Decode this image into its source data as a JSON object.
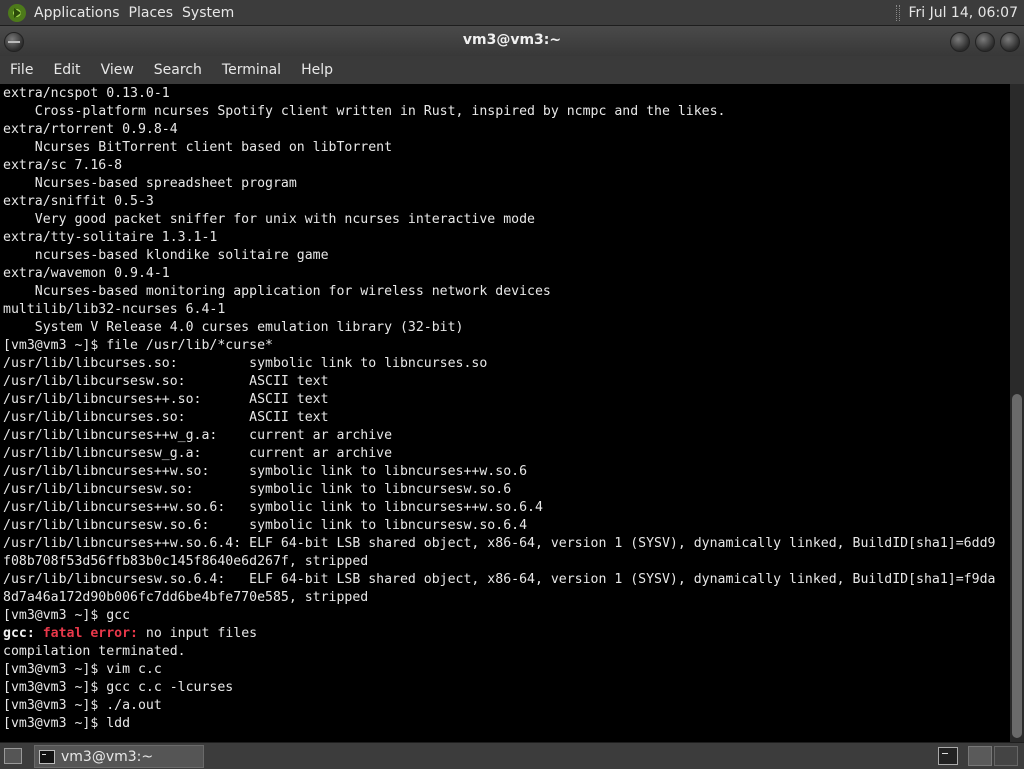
{
  "panel": {
    "menus": [
      "Applications",
      "Places",
      "System"
    ],
    "clock": "Fri Jul 14, 06:07"
  },
  "window": {
    "title": "vm3@vm3:~"
  },
  "menubar": [
    "File",
    "Edit",
    "View",
    "Search",
    "Terminal",
    "Help"
  ],
  "terminal": {
    "lines": [
      [
        {
          "t": "extra/ncspot 0.13.0-1"
        }
      ],
      [
        {
          "t": "    Cross-platform ncurses Spotify client written in Rust, inspired by ncmpc and the likes."
        }
      ],
      [
        {
          "t": "extra/rtorrent 0.9.8-4"
        }
      ],
      [
        {
          "t": "    Ncurses BitTorrent client based on libTorrent"
        }
      ],
      [
        {
          "t": "extra/sc 7.16-8"
        }
      ],
      [
        {
          "t": "    Ncurses-based spreadsheet program"
        }
      ],
      [
        {
          "t": "extra/sniffit 0.5-3"
        }
      ],
      [
        {
          "t": "    Very good packet sniffer for unix with ncurses interactive mode"
        }
      ],
      [
        {
          "t": "extra/tty-solitaire 1.3.1-1"
        }
      ],
      [
        {
          "t": "    ncurses-based klondike solitaire game"
        }
      ],
      [
        {
          "t": "extra/wavemon 0.9.4-1"
        }
      ],
      [
        {
          "t": "    Ncurses-based monitoring application for wireless network devices"
        }
      ],
      [
        {
          "t": "multilib/lib32-ncurses 6.4-1"
        }
      ],
      [
        {
          "t": "    System V Release 4.0 curses emulation library (32-bit)"
        }
      ],
      [
        {
          "t": "[vm3@vm3 ~]$ file /usr/lib/*curse*"
        }
      ],
      [
        {
          "t": "/usr/lib/libcurses.so:         symbolic link to libncurses.so"
        }
      ],
      [
        {
          "t": "/usr/lib/libcursesw.so:        ASCII text"
        }
      ],
      [
        {
          "t": "/usr/lib/libncurses++.so:      ASCII text"
        }
      ],
      [
        {
          "t": "/usr/lib/libncurses.so:        ASCII text"
        }
      ],
      [
        {
          "t": "/usr/lib/libncurses++w_g.a:    current ar archive"
        }
      ],
      [
        {
          "t": "/usr/lib/libncursesw_g.a:      current ar archive"
        }
      ],
      [
        {
          "t": "/usr/lib/libncurses++w.so:     symbolic link to libncurses++w.so.6"
        }
      ],
      [
        {
          "t": "/usr/lib/libncursesw.so:       symbolic link to libncursesw.so.6"
        }
      ],
      [
        {
          "t": "/usr/lib/libncurses++w.so.6:   symbolic link to libncurses++w.so.6.4"
        }
      ],
      [
        {
          "t": "/usr/lib/libncursesw.so.6:     symbolic link to libncursesw.so.6.4"
        }
      ],
      [
        {
          "t": "/usr/lib/libncurses++w.so.6.4: ELF 64-bit LSB shared object, x86-64, version 1 (SYSV), dynamically linked, BuildID[sha1]=6dd9"
        }
      ],
      [
        {
          "t": "f08b708f53d56ffb83b0c145f8640e6d267f, stripped"
        }
      ],
      [
        {
          "t": "/usr/lib/libncursesw.so.6.4:   ELF 64-bit LSB shared object, x86-64, version 1 (SYSV), dynamically linked, BuildID[sha1]=f9da"
        }
      ],
      [
        {
          "t": "8d7a46a172d90b006fc7dd6be4bfe770e585, stripped"
        }
      ],
      [
        {
          "t": "[vm3@vm3 ~]$ gcc"
        }
      ],
      [
        {
          "t": "gcc: ",
          "s": "bold"
        },
        {
          "t": "fatal error: ",
          "s": "red"
        },
        {
          "t": "no input files"
        }
      ],
      [
        {
          "t": "compilation terminated."
        }
      ],
      [
        {
          "t": "[vm3@vm3 ~]$ vim c.c"
        }
      ],
      [
        {
          "t": "[vm3@vm3 ~]$ gcc c.c -lcurses"
        }
      ],
      [
        {
          "t": "[vm3@vm3 ~]$ ./a.out"
        }
      ],
      [
        {
          "t": "[vm3@vm3 ~]$ ldd"
        }
      ]
    ]
  },
  "taskbar": {
    "window_label": "vm3@vm3:~"
  },
  "icons": {
    "app_menu": "distro-logo-icon",
    "show_desktop": "show-desktop-icon",
    "terminal": "terminal-icon"
  }
}
